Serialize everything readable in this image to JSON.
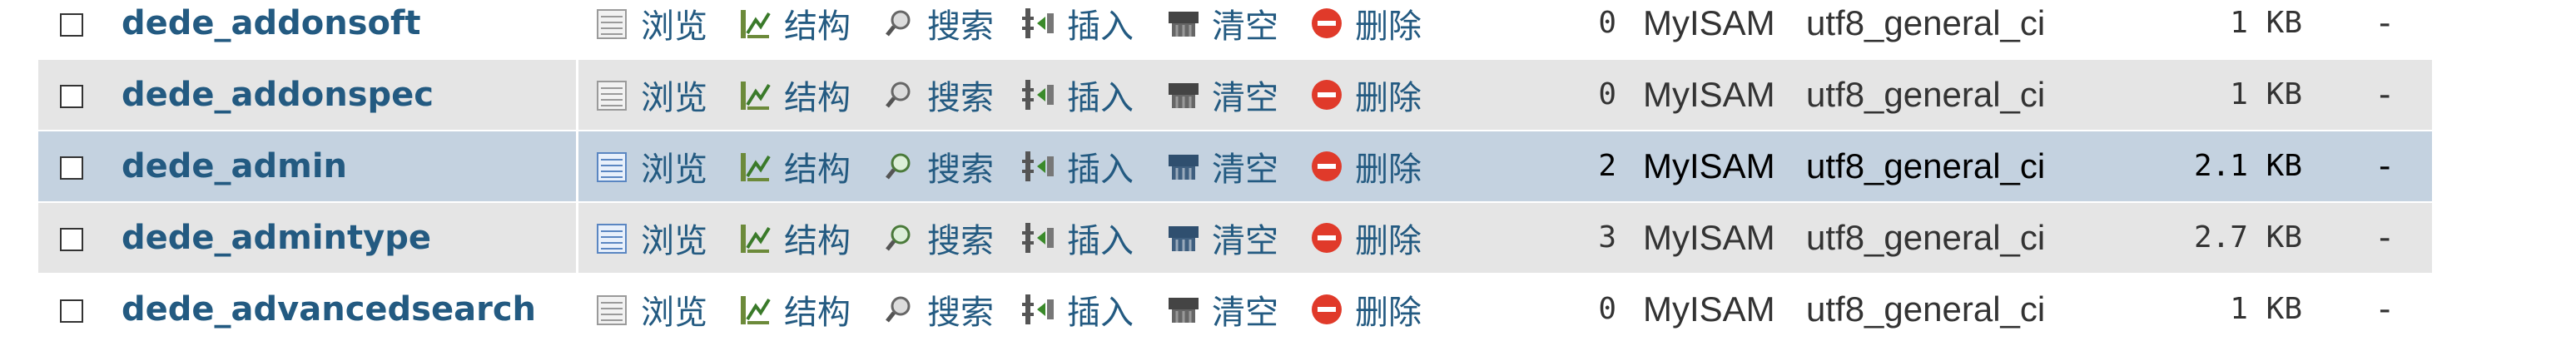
{
  "actions": {
    "browse": "浏览",
    "structure": "结构",
    "search": "搜索",
    "insert": "插入",
    "empty": "清空",
    "drop": "删除"
  },
  "rows": [
    {
      "name": "dede_addonsoft",
      "rows": "0",
      "engine": "MyISAM",
      "collation": "utf8_general_ci",
      "size": "1 KB",
      "overhead": "-"
    },
    {
      "name": "dede_addonspec",
      "rows": "0",
      "engine": "MyISAM",
      "collation": "utf8_general_ci",
      "size": "1 KB",
      "overhead": "-"
    },
    {
      "name": "dede_admin",
      "rows": "2",
      "engine": "MyISAM",
      "collation": "utf8_general_ci",
      "size": "2.1 KB",
      "overhead": "-"
    },
    {
      "name": "dede_admintype",
      "rows": "3",
      "engine": "MyISAM",
      "collation": "utf8_general_ci",
      "size": "2.7 KB",
      "overhead": "-"
    },
    {
      "name": "dede_advancedsearch",
      "rows": "0",
      "engine": "MyISAM",
      "collation": "utf8_general_ci",
      "size": "1 KB",
      "overhead": "-"
    }
  ]
}
